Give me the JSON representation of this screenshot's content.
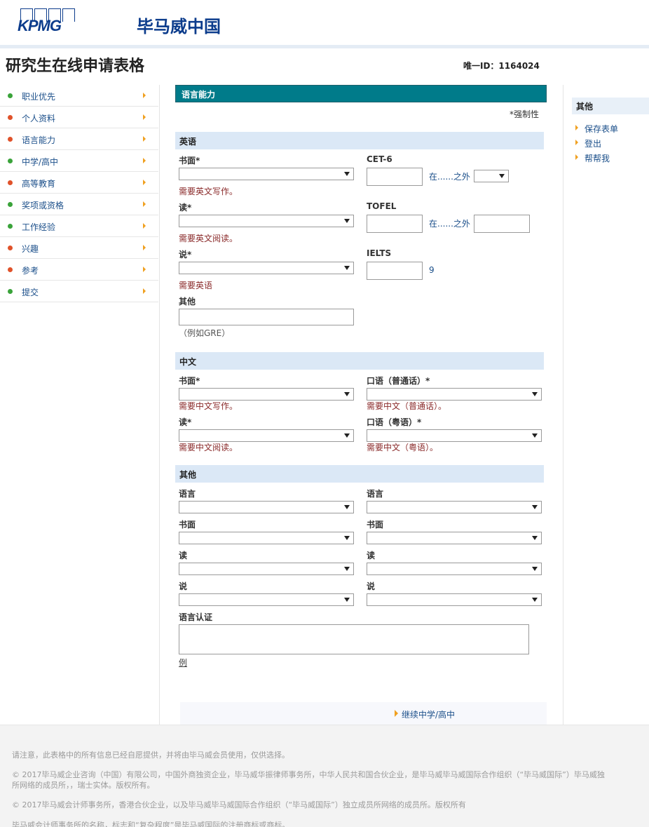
{
  "header": {
    "logo_text": "KPMG",
    "brand_cn": "毕马威中国"
  },
  "page": {
    "title": "研究生在线申请表格",
    "unique_id": "唯一ID：1164024"
  },
  "left_nav": [
    {
      "label": "职业优先",
      "status_color": "#3aa33a"
    },
    {
      "label": "个人资料",
      "status_color": "#e0522a"
    },
    {
      "label": "语言能力",
      "status_color": "#e0522a"
    },
    {
      "label": "中学/高中",
      "status_color": "#3aa33a"
    },
    {
      "label": "高等教育",
      "status_color": "#e0522a"
    },
    {
      "label": "奖项或资格",
      "status_color": "#3aa33a"
    },
    {
      "label": "工作经验",
      "status_color": "#3aa33a"
    },
    {
      "label": "兴趣",
      "status_color": "#e0522a"
    },
    {
      "label": "参考",
      "status_color": "#e0522a"
    },
    {
      "label": "提交",
      "status_color": "#3aa33a"
    }
  ],
  "right_panel": {
    "title": "其他",
    "links": [
      "保存表单",
      "登出",
      "帮帮我"
    ]
  },
  "form": {
    "section_title": "语言能力",
    "mandatory_note": "*强制性",
    "english": {
      "heading": "英语",
      "written_label": "书面*",
      "written_error": "需要英文写作。",
      "reading_label": "读*",
      "reading_error": "需要英文阅读。",
      "speaking_label": "说*",
      "speaking_error": "需要英语",
      "other_label": "其他",
      "other_hint": "（例如GRE）",
      "cet6_label": "CET-6",
      "cet6_within": "在......之外",
      "tofel_label": "TOFEL",
      "tofel_within": "在......之外",
      "ielts_label": "IELTS",
      "ielts_suffix": "9"
    },
    "chinese": {
      "heading": "中文",
      "written_label": "书面*",
      "written_error": "需要中文写作。",
      "reading_label": "读*",
      "reading_error": "需要中文阅读。",
      "mandarin_label": "口语（普通话）*",
      "mandarin_error": "需要中文（普通话）。",
      "cantonese_label": "口语（粤语）*",
      "cantonese_error": "需要中文（粤语）。"
    },
    "other": {
      "heading": "其他",
      "language_label": "语言",
      "written_label": "书面",
      "reading_label": "读",
      "speaking_label": "说",
      "certification_label": "语言认证",
      "example_link": "例"
    },
    "continue_link": "继续中学/高中"
  },
  "footer": {
    "line1": "请注意，此表格中的所有信息已经自愿提供，并将由毕马威会员使用，仅供选择。",
    "line2a": "© 2017毕马威企业咨询（中国）有限公司，中国外商独资企业，毕马威华振律师事务所，中华人民共和国合伙企业，是毕马威毕马威国际合作组织（“毕马威国际”）毕马威独",
    "line2b": "所网络的成员所，，瑞士实体。版权所有。",
    "line3": "© 2017毕马威会计师事务所，香港合伙企业，以及毕马威毕马威国际合作组织（“毕马威国际”）独立成员所网络的成员所。版权所有",
    "line4": "毕马威会计师事务所的名称，标志和“复杂程度”是毕马威国际的注册商标或商标。"
  }
}
